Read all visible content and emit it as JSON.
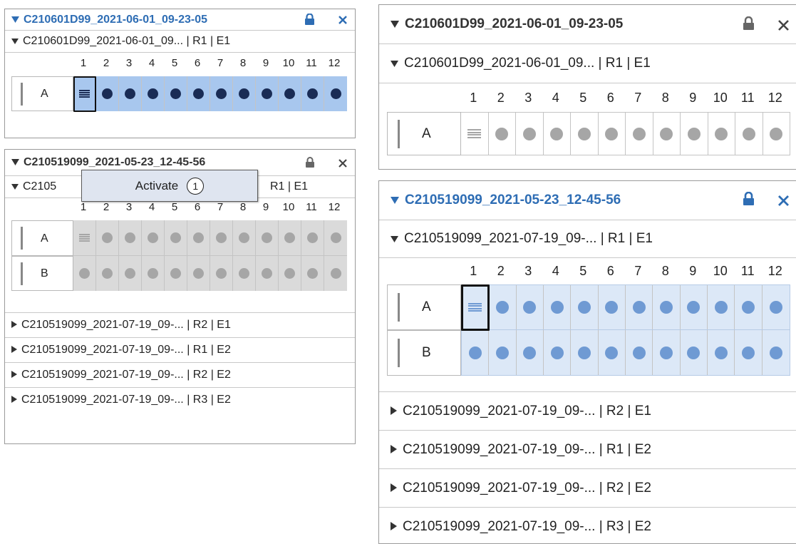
{
  "left": {
    "top_panel": {
      "title": "C210601D99_2021-06-01_09-23-05",
      "run_label": "C210601D99_2021-06-01_09... | R1 | E1",
      "rows": [
        "A"
      ],
      "state": "active",
      "selected_well": "A1"
    },
    "bottom_panel": {
      "title": "C210519099_2021-05-23_12-45-56",
      "run_label_prefix": "C2105",
      "run_label_suffix": "R1 | E1",
      "rows": [
        "A",
        "B"
      ],
      "state": "inactive",
      "other_runs": [
        "C210519099_2021-07-19_09-... | R2 | E1",
        "C210519099_2021-07-19_09-... | R1 | E2",
        "C210519099_2021-07-19_09-... | R2 | E2",
        "C210519099_2021-07-19_09-... | R3 | E2"
      ]
    },
    "context_menu": {
      "label": "Activate",
      "step_badge": "1"
    }
  },
  "right": {
    "top_panel": {
      "title": "C210601D99_2021-06-01_09-23-05",
      "run_label": "C210601D99_2021-06-01_09... | R1 | E1",
      "rows": [
        "A"
      ],
      "state": "inactive"
    },
    "bottom_panel": {
      "title": "C210519099_2021-05-23_12-45-56",
      "run_label": "C210519099_2021-07-19_09-... | R1 | E1",
      "rows": [
        "A",
        "B"
      ],
      "state": "active",
      "selected_well": "A1",
      "other_runs": [
        "C210519099_2021-07-19_09-... | R2 | E1",
        "C210519099_2021-07-19_09-... | R1 | E2",
        "C210519099_2021-07-19_09-... | R2 | E2",
        "C210519099_2021-07-19_09-... | R3 | E2"
      ]
    }
  },
  "column_numbers": [
    "1",
    "2",
    "3",
    "4",
    "5",
    "6",
    "7",
    "8",
    "9",
    "10",
    "11",
    "12"
  ],
  "icons": {
    "expand": "triangle-down-icon",
    "collapse": "triangle-right-icon",
    "lock": "lock-icon",
    "close": "close-icon",
    "well_first": "lines-icon",
    "well": "dot-icon"
  },
  "colors": {
    "active_title": "#2e6db4",
    "active_well_bg": "#a8c7ee",
    "active_dot": "#1a2c55",
    "active_well_bg_light": "#dce8f7",
    "active_dot_light": "#6f9ad3",
    "inactive_well_bg": "#dadada",
    "inactive_dot": "#a6a6a6",
    "menu_bg": "#dfe5f0"
  }
}
